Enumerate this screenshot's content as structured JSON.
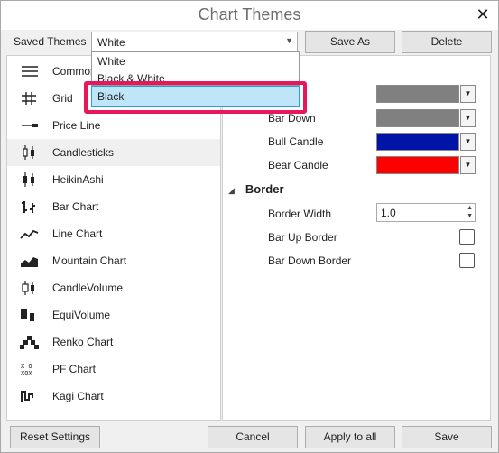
{
  "window": {
    "title": "Chart Themes",
    "close": "✕"
  },
  "themes": {
    "label": "Saved Themes",
    "selected": "White",
    "dropdown": [
      "White",
      "Black & White",
      "Black"
    ],
    "save_as": "Save As",
    "delete": "Delete"
  },
  "nav": {
    "items": [
      {
        "label": "Common",
        "icon": "lines-icon"
      },
      {
        "label": "Grid",
        "icon": "grid-icon"
      },
      {
        "label": "Price Line",
        "icon": "price-line-icon"
      },
      {
        "label": "Candlesticks",
        "icon": "candlesticks-icon",
        "selected": true
      },
      {
        "label": "HeikinAshi",
        "icon": "heikinashi-icon"
      },
      {
        "label": "Bar Chart",
        "icon": "bar-chart-icon"
      },
      {
        "label": "Line Chart",
        "icon": "line-chart-icon"
      },
      {
        "label": "Mountain Chart",
        "icon": "mountain-chart-icon"
      },
      {
        "label": "CandleVolume",
        "icon": "candlevolume-icon"
      },
      {
        "label": "EquiVolume",
        "icon": "equivolume-icon"
      },
      {
        "label": "Renko Chart",
        "icon": "renko-icon"
      },
      {
        "label": "PF Chart",
        "icon": "pf-chart-icon"
      },
      {
        "label": "Kagi Chart",
        "icon": "kagi-chart-icon"
      }
    ]
  },
  "props": {
    "colors": [
      {
        "label": "",
        "color": "#808080"
      },
      {
        "label": "Bar Down",
        "color": "#808080"
      },
      {
        "label": "Bull Candle",
        "color": "#0014a8"
      },
      {
        "label": "Bear Candle",
        "color": "#ff0000"
      }
    ],
    "border_section": "Border",
    "border_width_label": "Border Width",
    "border_width_value": "1.0",
    "bar_up_border": "Bar Up Border",
    "bar_down_border": "Bar Down Border"
  },
  "footer": {
    "reset": "Reset Settings",
    "cancel": "Cancel",
    "apply_all": "Apply to all",
    "save": "Save"
  }
}
